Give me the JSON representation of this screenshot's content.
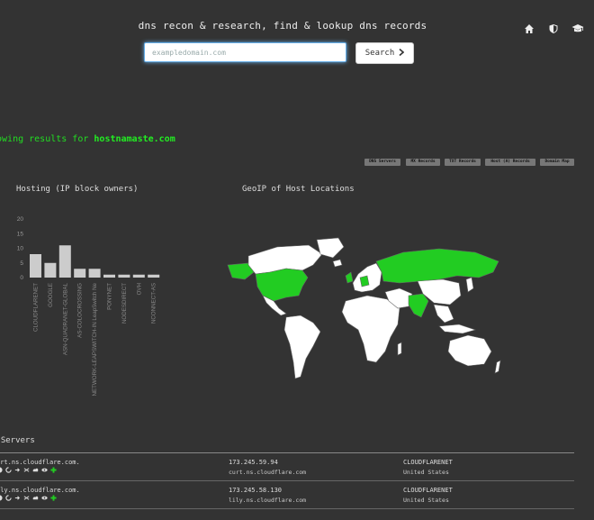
{
  "header": {
    "title": "dns recon & research, find & lookup dns records",
    "icons": [
      "home-icon",
      "shield-icon",
      "graduation-cap-icon"
    ]
  },
  "search": {
    "placeholder": "exampledomain.com",
    "value": "",
    "button_label": "Search"
  },
  "results": {
    "prefix": "howing results for",
    "domain": "hostnamaste.com"
  },
  "nav_buttons": [
    "DNS Servers",
    "MX Records",
    "TXT Records",
    "Host (A) Records",
    "Domain Map"
  ],
  "sections": {
    "hosting_title": "Hosting (IP block owners)",
    "geoip_title": "GeoIP of Host Locations",
    "dns_title": "S Servers"
  },
  "chart_data": {
    "type": "bar",
    "title": "Hosting (IP block owners)",
    "categories": [
      "CLOUDFLARENET",
      "GOOGLE",
      "ASN-QUADRANET-GLOBAL",
      "AS-COLOCROSSING",
      "NETWORK-LEAPSWITCH-IN LeapSwitch Ne",
      "PONYNET",
      "NODESDIRECT",
      "OVH",
      "NCONNECT-AS"
    ],
    "values": [
      8,
      5,
      11,
      3,
      3,
      1,
      1,
      1,
      1
    ],
    "yticks": [
      0,
      5,
      10,
      15,
      20
    ],
    "ylim": [
      0,
      20
    ],
    "bar_color": "#cccccc"
  },
  "map": {
    "highlight_color": "#22cc22",
    "base_color": "#ffffff",
    "highlighted": [
      "United States",
      "Canada",
      "Russia",
      "India",
      "Germany",
      "Netherlands",
      "United Kingdom"
    ]
  },
  "dns_servers": [
    {
      "name": "urt.ns.cloudflare.com.",
      "ip": "173.245.59.94",
      "reverse": "curt.ns.cloudflare.com",
      "owner": "CLOUDFLARENET",
      "country": "United States"
    },
    {
      "name": "ily.ns.cloudflare.com.",
      "ip": "173.245.58.130",
      "reverse": "lily.ns.cloudflare.com",
      "owner": "CLOUDFLARENET",
      "country": "United States"
    }
  ]
}
